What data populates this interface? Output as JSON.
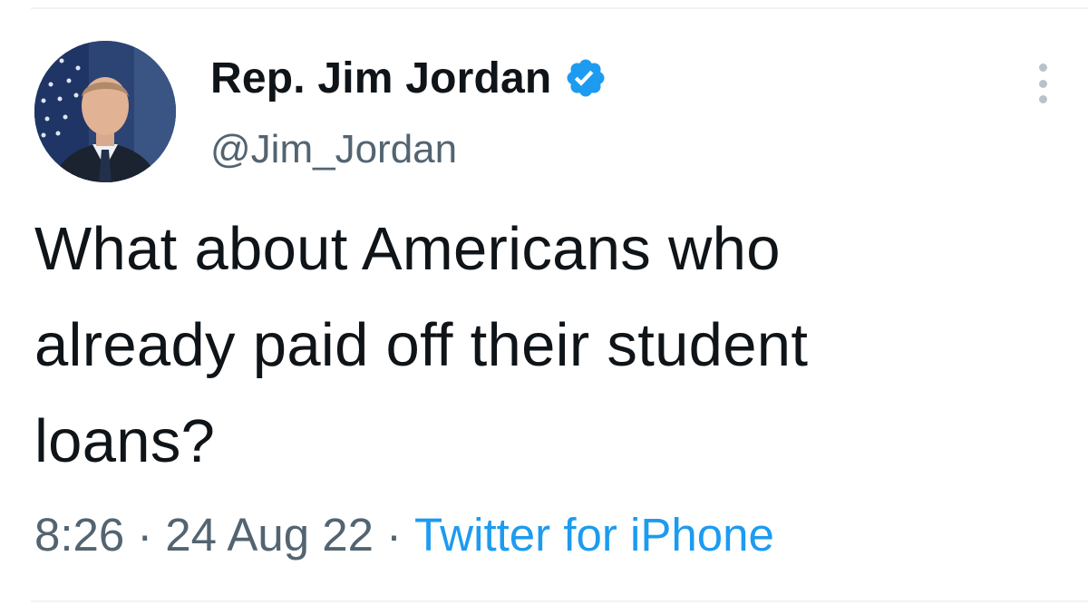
{
  "tweet": {
    "author": {
      "display_name": "Rep. Jim Jordan",
      "handle": "@Jim_Jordan",
      "verified": true,
      "avatar_icon": "profile-photo"
    },
    "text": "What about Americans who\nalready paid off their student\nloans?",
    "meta": {
      "time": "8:26",
      "separator": "·",
      "date": "24 Aug 22",
      "source": "Twitter for iPhone"
    },
    "more_icon": "more-dots-vertical-icon"
  },
  "colors": {
    "text_primary": "#0f1419",
    "text_secondary": "#536471",
    "accent": "#1d9bf0",
    "divider": "#eff3f4"
  }
}
